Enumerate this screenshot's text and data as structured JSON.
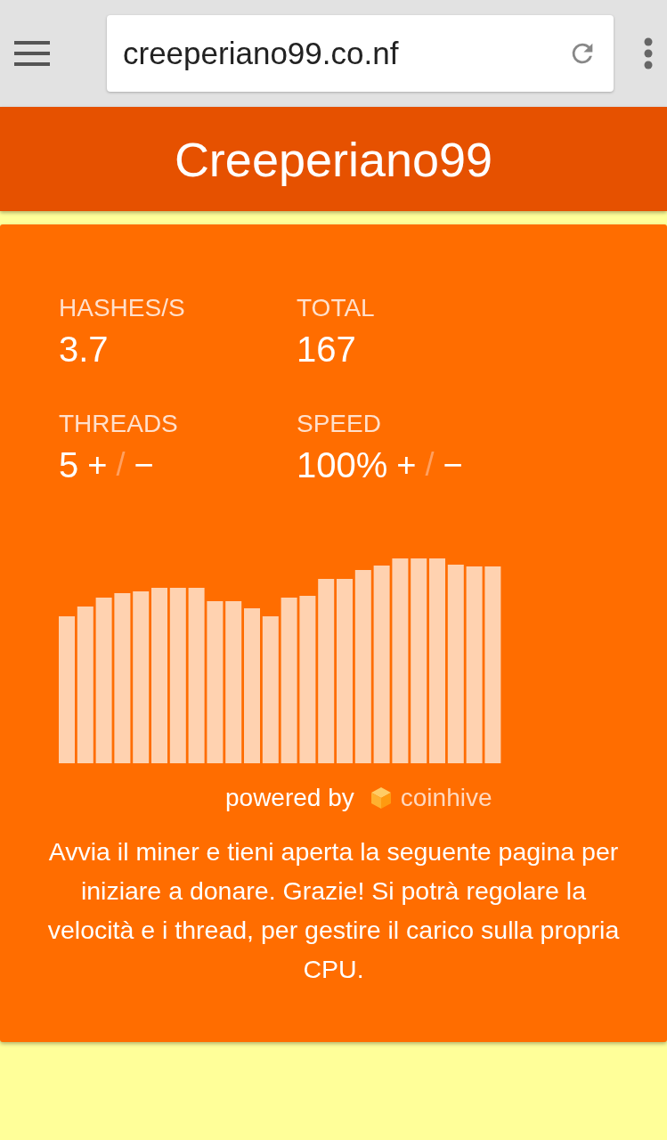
{
  "browser": {
    "url": "creeperiano99.co.nf"
  },
  "header": {
    "title": "Creeperiano99"
  },
  "stats": [
    {
      "kind": "plain",
      "label": "HASHES/S",
      "value": "3.7"
    },
    {
      "kind": "plain",
      "label": "TOTAL",
      "value": "167"
    },
    {
      "kind": "adjust",
      "label": "THREADS",
      "value": "5",
      "plus": "+",
      "separator": "/",
      "minus": "−"
    },
    {
      "kind": "adjust",
      "label": "SPEED",
      "value": "100%",
      "plus": "+",
      "separator": "/",
      "minus": "−"
    }
  ],
  "footer": {
    "powered_by": "powered by",
    "brand": "coinhive"
  },
  "message": "Avvia il miner e tieni aperta la seguente pagina per iniziare a donare. Grazie! Si potrà regolare la velocità e i thread, per gestire il carico sulla propria CPU."
}
